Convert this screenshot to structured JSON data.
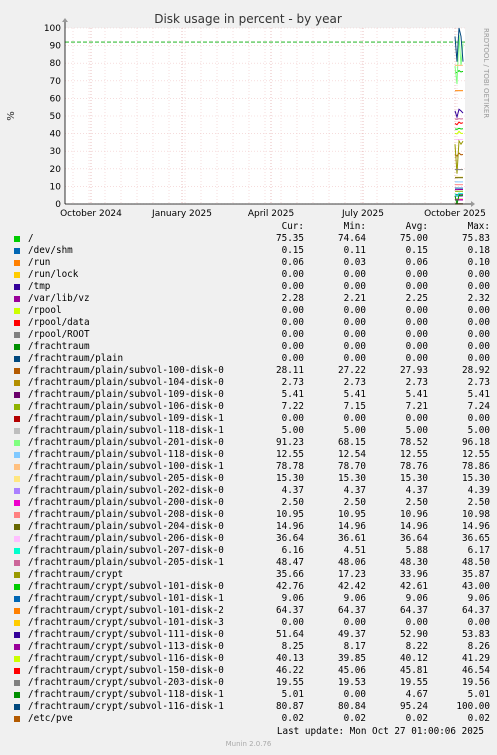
{
  "chart_data": {
    "type": "line",
    "title": "Disk usage in percent - by year",
    "ylabel": "%",
    "ylim": [
      0,
      100
    ],
    "y_ticks": [
      "0",
      "10",
      "20",
      "30",
      "40",
      "50",
      "60",
      "70",
      "80",
      "90",
      "100"
    ],
    "x_ticks": [
      "October 2024",
      "January 2025",
      "April 2025",
      "July 2025",
      "October 2025"
    ],
    "side_label": "RRDTOOL / TOBI OETIKER",
    "warning_line": 92,
    "grid": true,
    "legend_headers": [
      "Cur:",
      "Min:",
      "Avg:",
      "Max:"
    ],
    "series": [
      {
        "name": "/",
        "color": "#00cc00",
        "cur": "75.35",
        "min": "74.64",
        "avg": "75.00",
        "max": "75.83"
      },
      {
        "name": "/dev/shm",
        "color": "#0066b3",
        "cur": "0.15",
        "min": "0.11",
        "avg": "0.15",
        "max": "0.18"
      },
      {
        "name": "/run",
        "color": "#ff8000",
        "cur": "0.06",
        "min": "0.03",
        "avg": "0.06",
        "max": "0.10"
      },
      {
        "name": "/run/lock",
        "color": "#ffcc00",
        "cur": "0.00",
        "min": "0.00",
        "avg": "0.00",
        "max": "0.00"
      },
      {
        "name": "/tmp",
        "color": "#330099",
        "cur": "0.00",
        "min": "0.00",
        "avg": "0.00",
        "max": "0.00"
      },
      {
        "name": "/var/lib/vz",
        "color": "#990099",
        "cur": "2.28",
        "min": "2.21",
        "avg": "2.25",
        "max": "2.32"
      },
      {
        "name": "/rpool",
        "color": "#ccff00",
        "cur": "0.00",
        "min": "0.00",
        "avg": "0.00",
        "max": "0.00"
      },
      {
        "name": "/rpool/data",
        "color": "#ff0000",
        "cur": "0.00",
        "min": "0.00",
        "avg": "0.00",
        "max": "0.00"
      },
      {
        "name": "/rpool/ROOT",
        "color": "#808080",
        "cur": "0.00",
        "min": "0.00",
        "avg": "0.00",
        "max": "0.00"
      },
      {
        "name": "/frachtraum",
        "color": "#008f00",
        "cur": "0.00",
        "min": "0.00",
        "avg": "0.00",
        "max": "0.00"
      },
      {
        "name": "/frachtraum/plain",
        "color": "#00487d",
        "cur": "0.00",
        "min": "0.00",
        "avg": "0.00",
        "max": "0.00"
      },
      {
        "name": "/frachtraum/plain/subvol-100-disk-0",
        "color": "#b35a00",
        "cur": "28.11",
        "min": "27.22",
        "avg": "27.93",
        "max": "28.92"
      },
      {
        "name": "/frachtraum/plain/subvol-104-disk-0",
        "color": "#b38f00",
        "cur": "2.73",
        "min": "2.73",
        "avg": "2.73",
        "max": "2.73"
      },
      {
        "name": "/frachtraum/plain/subvol-109-disk-0",
        "color": "#6b006b",
        "cur": "5.41",
        "min": "5.41",
        "avg": "5.41",
        "max": "5.41"
      },
      {
        "name": "/frachtraum/plain/subvol-106-disk-0",
        "color": "#8fb300",
        "cur": "7.22",
        "min": "7.15",
        "avg": "7.21",
        "max": "7.24"
      },
      {
        "name": "/frachtraum/plain/subvol-109-disk-1",
        "color": "#b30000",
        "cur": "0.00",
        "min": "0.00",
        "avg": "0.00",
        "max": "0.00"
      },
      {
        "name": "/frachtraum/plain/subvol-118-disk-1",
        "color": "#bebebe",
        "cur": "5.00",
        "min": "5.00",
        "avg": "5.00",
        "max": "5.00"
      },
      {
        "name": "/frachtraum/plain/subvol-201-disk-0",
        "color": "#80ff80",
        "cur": "91.23",
        "min": "68.15",
        "avg": "78.52",
        "max": "96.18"
      },
      {
        "name": "/frachtraum/plain/subvol-118-disk-0",
        "color": "#80c9ff",
        "cur": "12.55",
        "min": "12.54",
        "avg": "12.55",
        "max": "12.55"
      },
      {
        "name": "/frachtraum/plain/subvol-100-disk-1",
        "color": "#ffc080",
        "cur": "78.78",
        "min": "78.70",
        "avg": "78.76",
        "max": "78.86"
      },
      {
        "name": "/frachtraum/plain/subvol-205-disk-0",
        "color": "#ffe680",
        "cur": "15.30",
        "min": "15.30",
        "avg": "15.30",
        "max": "15.30"
      },
      {
        "name": "/frachtraum/plain/subvol-202-disk-0",
        "color": "#aa80ff",
        "cur": "4.37",
        "min": "4.37",
        "avg": "4.37",
        "max": "4.39"
      },
      {
        "name": "/frachtraum/plain/subvol-200-disk-0",
        "color": "#ee00cc",
        "cur": "2.50",
        "min": "2.50",
        "avg": "2.50",
        "max": "2.50"
      },
      {
        "name": "/frachtraum/plain/subvol-208-disk-0",
        "color": "#ff8080",
        "cur": "10.95",
        "min": "10.95",
        "avg": "10.96",
        "max": "10.98"
      },
      {
        "name": "/frachtraum/plain/subvol-204-disk-0",
        "color": "#666600",
        "cur": "14.96",
        "min": "14.96",
        "avg": "14.96",
        "max": "14.96"
      },
      {
        "name": "/frachtraum/plain/subvol-206-disk-0",
        "color": "#ffbfff",
        "cur": "36.64",
        "min": "36.61",
        "avg": "36.64",
        "max": "36.65"
      },
      {
        "name": "/frachtraum/plain/subvol-207-disk-0",
        "color": "#00ffcc",
        "cur": "6.16",
        "min": "4.51",
        "avg": "5.88",
        "max": "6.17"
      },
      {
        "name": "/frachtraum/plain/subvol-205-disk-1",
        "color": "#cc6699",
        "cur": "48.47",
        "min": "48.06",
        "avg": "48.30",
        "max": "48.50"
      },
      {
        "name": "/frachtraum/crypt",
        "color": "#999900",
        "cur": "35.66",
        "min": "17.23",
        "avg": "33.96",
        "max": "35.87"
      },
      {
        "name": "/frachtraum/crypt/subvol-101-disk-0",
        "color": "#00cc00",
        "cur": "42.76",
        "min": "42.42",
        "avg": "42.61",
        "max": "43.00"
      },
      {
        "name": "/frachtraum/crypt/subvol-101-disk-1",
        "color": "#0066b3",
        "cur": "9.06",
        "min": "9.06",
        "avg": "9.06",
        "max": "9.06"
      },
      {
        "name": "/frachtraum/crypt/subvol-101-disk-2",
        "color": "#ff8000",
        "cur": "64.37",
        "min": "64.37",
        "avg": "64.37",
        "max": "64.37"
      },
      {
        "name": "/frachtraum/crypt/subvol-101-disk-3",
        "color": "#ffcc00",
        "cur": "0.00",
        "min": "0.00",
        "avg": "0.00",
        "max": "0.00"
      },
      {
        "name": "/frachtraum/crypt/subvol-111-disk-0",
        "color": "#330099",
        "cur": "51.64",
        "min": "49.37",
        "avg": "52.90",
        "max": "53.83"
      },
      {
        "name": "/frachtraum/crypt/subvol-113-disk-0",
        "color": "#990099",
        "cur": "8.25",
        "min": "8.17",
        "avg": "8.22",
        "max": "8.26"
      },
      {
        "name": "/frachtraum/crypt/subvol-116-disk-0",
        "color": "#ccff00",
        "cur": "40.13",
        "min": "39.85",
        "avg": "40.12",
        "max": "41.29"
      },
      {
        "name": "/frachtraum/crypt/subvol-150-disk-0",
        "color": "#ff0000",
        "cur": "46.22",
        "min": "45.06",
        "avg": "45.81",
        "max": "46.54"
      },
      {
        "name": "/frachtraum/crypt/subvol-203-disk-0",
        "color": "#808080",
        "cur": "19.55",
        "min": "19.53",
        "avg": "19.55",
        "max": "19.56"
      },
      {
        "name": "/frachtraum/crypt/subvol-118-disk-1",
        "color": "#008f00",
        "cur": "5.01",
        "min": "0.00",
        "avg": "4.67",
        "max": "5.01"
      },
      {
        "name": "/frachtraum/crypt/subvol-116-disk-1",
        "color": "#00487d",
        "cur": "80.87",
        "min": "80.84",
        "avg": "95.24",
        "max": "100.00"
      },
      {
        "name": "/etc/pve",
        "color": "#b35a00",
        "cur": "0.02",
        "min": "0.02",
        "avg": "0.02",
        "max": "0.02"
      }
    ]
  },
  "footer": {
    "last_update": "Last update: Mon Oct 27 01:00:06 2025",
    "munin": "Munin 2.0.76"
  }
}
